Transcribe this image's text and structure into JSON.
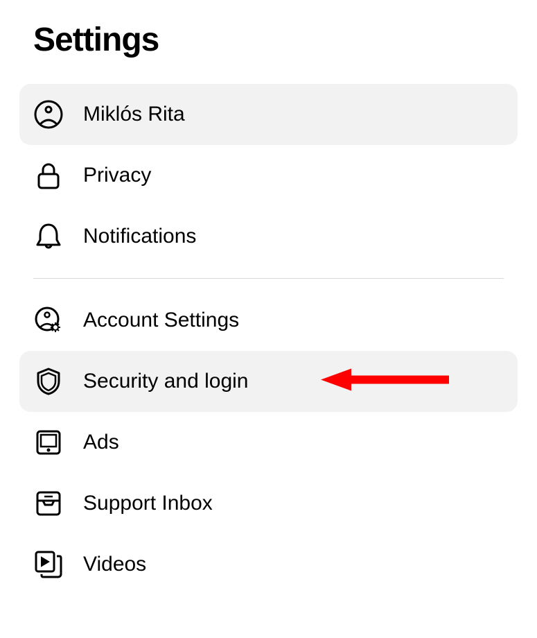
{
  "page": {
    "title": "Settings"
  },
  "menu": {
    "group1": [
      {
        "label": "Miklós Rita",
        "icon": "user-circle-icon",
        "highlighted": true
      },
      {
        "label": "Privacy",
        "icon": "lock-icon",
        "highlighted": false
      },
      {
        "label": "Notifications",
        "icon": "bell-icon",
        "highlighted": false
      }
    ],
    "group2": [
      {
        "label": "Account Settings",
        "icon": "user-gear-icon",
        "highlighted": false
      },
      {
        "label": "Security and login",
        "icon": "shield-icon",
        "highlighted": true,
        "arrow": true
      },
      {
        "label": "Ads",
        "icon": "tablet-icon",
        "highlighted": false
      },
      {
        "label": "Support Inbox",
        "icon": "inbox-icon",
        "highlighted": false
      },
      {
        "label": "Videos",
        "icon": "video-stack-icon",
        "highlighted": false
      }
    ]
  },
  "annotation": {
    "arrow_color": "#ff0000"
  }
}
